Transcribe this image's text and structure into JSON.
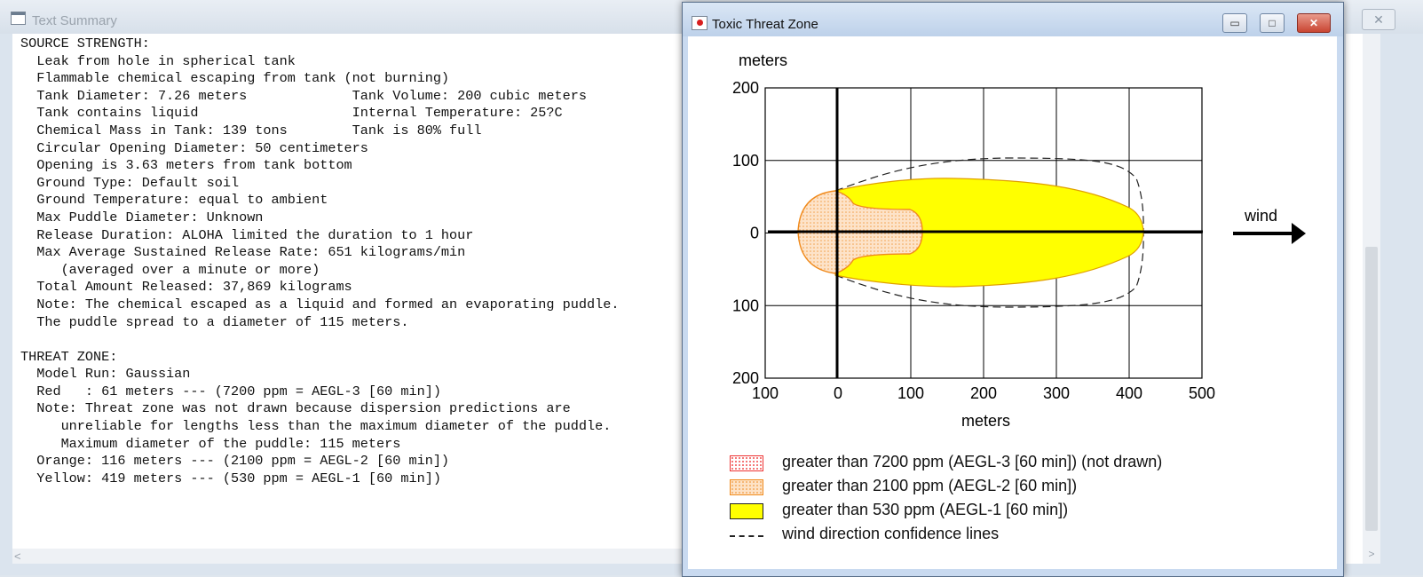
{
  "text_window": {
    "title": "Text Summary",
    "close_label": "✕",
    "summary_lines": [
      "SOURCE STRENGTH:",
      "  Leak from hole in spherical tank",
      "  Flammable chemical escaping from tank (not burning)",
      "  Tank Diameter: 7.26 meters             Tank Volume: 200 cubic meters",
      "  Tank contains liquid                   Internal Temperature: 25?C",
      "  Chemical Mass in Tank: 139 tons        Tank is 80% full",
      "  Circular Opening Diameter: 50 centimeters",
      "  Opening is 3.63 meters from tank bottom",
      "  Ground Type: Default soil",
      "  Ground Temperature: equal to ambient",
      "  Max Puddle Diameter: Unknown",
      "  Release Duration: ALOHA limited the duration to 1 hour",
      "  Max Average Sustained Release Rate: 651 kilograms/min",
      "     (averaged over a minute or more)",
      "  Total Amount Released: 37,869 kilograms",
      "  Note: The chemical escaped as a liquid and formed an evaporating puddle.",
      "  The puddle spread to a diameter of 115 meters.",
      "",
      "THREAT ZONE:",
      "  Model Run: Gaussian",
      "  Red   : 61 meters --- (7200 ppm = AEGL-3 [60 min])",
      "  Note: Threat zone was not drawn because dispersion predictions are",
      "     unreliable for lengths less than the maximum diameter of the puddle.",
      "     Maximum diameter of the puddle: 115 meters",
      "  Orange: 116 meters --- (2100 ppm = AEGL-2 [60 min])",
      "  Yellow: 419 meters --- (530 ppm = AEGL-1 [60 min])"
    ],
    "scroll_left_arrow": "<",
    "scroll_right_arrow": ">",
    "scroll_down_arrow": "∨"
  },
  "zone_window": {
    "title": "Toxic Threat Zone",
    "buttons": {
      "minimize": "▭",
      "maximize": "□",
      "close": "✕"
    },
    "plot": {
      "y_unit_label": "meters",
      "x_unit_label": "meters",
      "wind_label": "wind",
      "x_ticks": [
        "100",
        "0",
        "100",
        "200",
        "300",
        "400",
        "500"
      ],
      "y_ticks": [
        "200",
        "100",
        "0",
        "100",
        "200"
      ],
      "x_range": [
        -100,
        500
      ],
      "y_range": [
        -200,
        200
      ],
      "zones": {
        "yellow_length_m": 419,
        "orange_length_m": 116,
        "puddle_diameter_m": 115
      },
      "colors": {
        "yellow": "#ffff00",
        "orange": "#f5a24a",
        "red": "#e33333"
      }
    },
    "legend": [
      {
        "label": "greater than 7200 ppm (AEGL-3 [60 min]) (not drawn)"
      },
      {
        "label": "greater than 2100 ppm (AEGL-2 [60 min])"
      },
      {
        "label": "greater than 530 ppm (AEGL-1 [60 min])"
      },
      {
        "label": "wind direction confidence lines"
      }
    ]
  }
}
